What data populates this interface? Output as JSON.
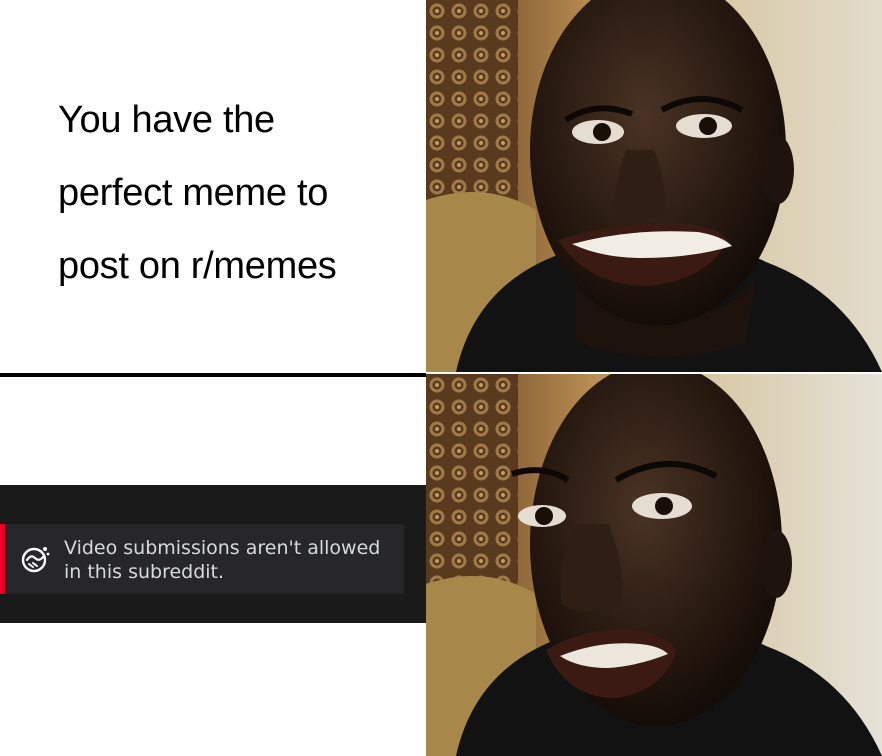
{
  "meme": {
    "caption_lines": [
      "You have the",
      "perfect meme to",
      "post on r/memes"
    ]
  },
  "toast": {
    "line1": "Video submissions aren't allowed",
    "line2": "in this subreddit.",
    "icon": "broken-heart-handshake-icon",
    "accent_color": "#ea0027",
    "background": "#272729",
    "strip_background": "#1a1a1b"
  },
  "photos": {
    "top": "man-smiling-photo",
    "bottom": "man-disappointed-photo"
  }
}
